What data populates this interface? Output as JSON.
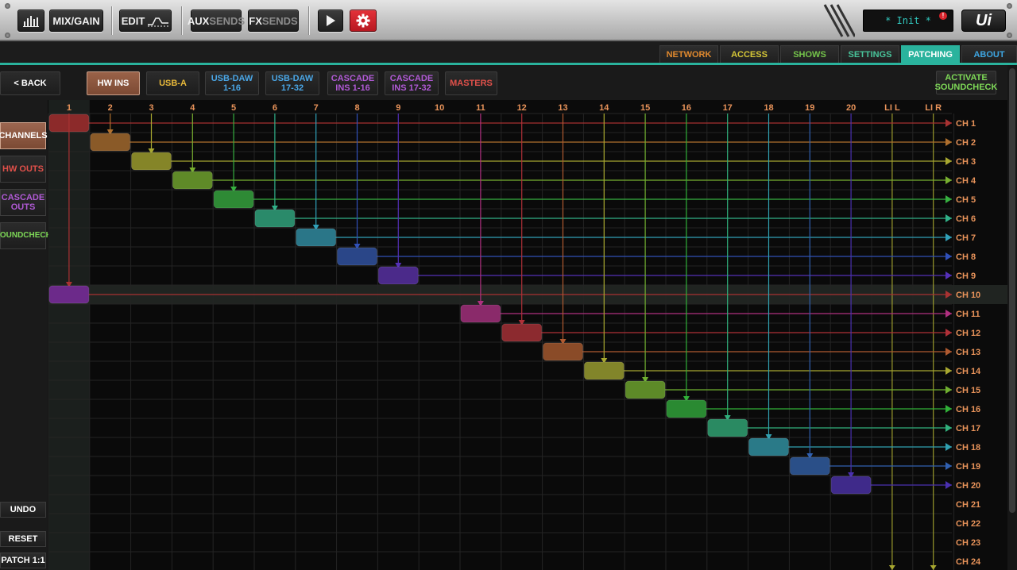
{
  "toolbar": {
    "meters_icon": "meters-icon",
    "mix_gain_label": "MIX/GAIN",
    "edit_label": "EDIT",
    "aux_sends": {
      "a": "AUX",
      "b": "SENDS"
    },
    "fx_sends": {
      "a": "FX",
      "b": "SENDS"
    },
    "play_icon": "play-icon",
    "settings_icon": "gear-icon",
    "display_text": "* Init *",
    "alert_badge": "!",
    "logo": "Ui"
  },
  "tabs": [
    {
      "label": "NETWORK",
      "color": "#e0892e"
    },
    {
      "label": "ACCESS",
      "color": "#d6c737"
    },
    {
      "label": "SHOWS",
      "color": "#74c44a"
    },
    {
      "label": "SETTINGS",
      "color": "#48c49a"
    },
    {
      "label": "PATCHING",
      "color": "#ffffff",
      "active": true
    },
    {
      "label": "ABOUT",
      "color": "#3ea6e2"
    }
  ],
  "subbar": {
    "back": "< BACK",
    "sources": [
      {
        "lines": [
          "HW INS"
        ],
        "color": "#ffffff",
        "active": true
      },
      {
        "lines": [
          "USB-A"
        ],
        "color": "#e8b93a"
      },
      {
        "lines": [
          "USB-DAW",
          "1-16"
        ],
        "color": "#4aa6e6"
      },
      {
        "lines": [
          "USB-DAW",
          "17-32"
        ],
        "color": "#4aa6e6"
      },
      {
        "lines": [
          "CASCADE",
          "INS 1-16"
        ],
        "color": "#b15ad6"
      },
      {
        "lines": [
          "CASCADE",
          "INS 17-32"
        ],
        "color": "#b15ad6"
      },
      {
        "lines": [
          "MASTERS"
        ],
        "color": "#e0504a"
      }
    ],
    "activate": [
      "ACTIVATE",
      "SOUNDCHECK"
    ],
    "activate_color": "#7ed957"
  },
  "left": {
    "channels": "CHANNELS",
    "hw_outs": "HW OUTS",
    "cascade": [
      "CASCADE",
      "OUTS"
    ],
    "soundcheck": "SOUNDCHECK",
    "undo": "UNDO",
    "reset": "RESET",
    "patch": "PATCH 1:1",
    "colors": {
      "hw_outs": "#e0504a",
      "cascade": "#b15ad6",
      "soundcheck": "#7ed957"
    }
  },
  "grid": {
    "columns": [
      "1",
      "2",
      "3",
      "4",
      "5",
      "6",
      "7",
      "8",
      "9",
      "10",
      "11",
      "12",
      "13",
      "14",
      "15",
      "16",
      "17",
      "18",
      "19",
      "20",
      "LI L",
      "LI R"
    ],
    "rows": [
      "CH 1",
      "CH 2",
      "CH 3",
      "CH 4",
      "CH 5",
      "CH 6",
      "CH 7",
      "CH 8",
      "CH 9",
      "CH 10",
      "CH 11",
      "CH 12",
      "CH 13",
      "CH 14",
      "CH 15",
      "CH 16",
      "CH 17",
      "CH 18",
      "CH 19",
      "CH 20",
      "CH 21",
      "CH 22",
      "CH 23",
      "CH 24"
    ],
    "label_color": "#e8935a",
    "selected_row": 9,
    "selected_col": 0,
    "patches": [
      {
        "row": 0,
        "col": 0,
        "color": "#8c2a2a"
      },
      {
        "row": 1,
        "col": 1,
        "color": "#8a5a28"
      },
      {
        "row": 2,
        "col": 2,
        "color": "#858528"
      },
      {
        "row": 3,
        "col": 3,
        "color": "#5f8a28"
      },
      {
        "row": 4,
        "col": 4,
        "color": "#2e8a35"
      },
      {
        "row": 5,
        "col": 5,
        "color": "#2a8a6a"
      },
      {
        "row": 6,
        "col": 6,
        "color": "#2a7688"
      },
      {
        "row": 7,
        "col": 7,
        "color": "#2a4688"
      },
      {
        "row": 8,
        "col": 8,
        "color": "#4b2a8a"
      },
      {
        "row": 9,
        "col": 0,
        "color": "#6c2a8a"
      },
      {
        "row": 10,
        "col": 10,
        "color": "#8a2a6a"
      },
      {
        "row": 11,
        "col": 11,
        "color": "#8c2a2f"
      },
      {
        "row": 12,
        "col": 12,
        "color": "#8a4b28"
      },
      {
        "row": 13,
        "col": 13,
        "color": "#82852a"
      },
      {
        "row": 14,
        "col": 14,
        "color": "#5d8a28"
      },
      {
        "row": 15,
        "col": 15,
        "color": "#2a8a32"
      },
      {
        "row": 16,
        "col": 16,
        "color": "#2a8a62"
      },
      {
        "row": 17,
        "col": 17,
        "color": "#2a7a88"
      },
      {
        "row": 18,
        "col": 18,
        "color": "#2a4f88"
      },
      {
        "row": 19,
        "col": 19,
        "color": "#3f2a8a"
      }
    ],
    "column_colors": [
      "#a83232",
      "#b0702e",
      "#a8a830",
      "#78b030",
      "#36b040",
      "#30b088",
      "#30a0b8",
      "#3050b8",
      "#5530b8",
      "#8030a8",
      "#b03080",
      "#b03038",
      "#b05a30",
      "#a8a830",
      "#70b030",
      "#30b038",
      "#30b07c",
      "#30a0b0",
      "#3060b0",
      "#4a30b0",
      "#a8a830",
      "#a8a830"
    ]
  }
}
